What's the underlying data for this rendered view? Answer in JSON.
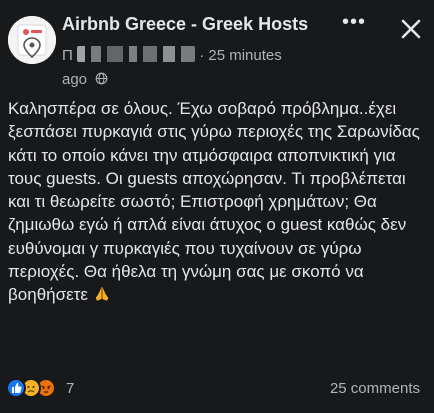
{
  "post": {
    "group_name": "Airbnb Greece - Greek Hosts",
    "author_initial": "Π",
    "time_ago": "25 minutes",
    "time_ago_suffix": "ago",
    "body": "Καλησπέρα σε όλους. Έχω σοβαρό πρόβλημα..έχει ξεσπάσει πυρκαγιά στις γύρω περιοχές της Σαρωνίδας κάτι το οποίο κάνει την ατμόσφαιρα αποπνικτική για τους guests. Οι guests αποχώρησαν. Τι προβλέπεται και τι θεωρείτε σωστό; Επιστροφή χρημάτων; Θα ζημιωθω εγώ ή απλά είναι άτυχος ο guest καθώς δεν ευθύνομαι γ πυρκαγιές που τυχαίνουν σε γύρω περιοχές. Θα ήθελα τη γνώμη σας με σκοπό να βοηθήσετε"
  },
  "icons": {
    "more": "more-horizontal-icon",
    "close": "close-icon",
    "audience": "globe-icon",
    "pray": "folded-hands-emoji"
  },
  "footer": {
    "reaction_count": "7",
    "reactions": [
      "like",
      "sad",
      "angry"
    ],
    "comments": "25 comments"
  },
  "colors": {
    "background": "#18191a",
    "primary_text": "#e4e6eb",
    "secondary_text": "#b0b3b8",
    "like_blue": "#1877f2",
    "sad_yellow": "#f7b125",
    "angry_orange": "#e9710f"
  }
}
